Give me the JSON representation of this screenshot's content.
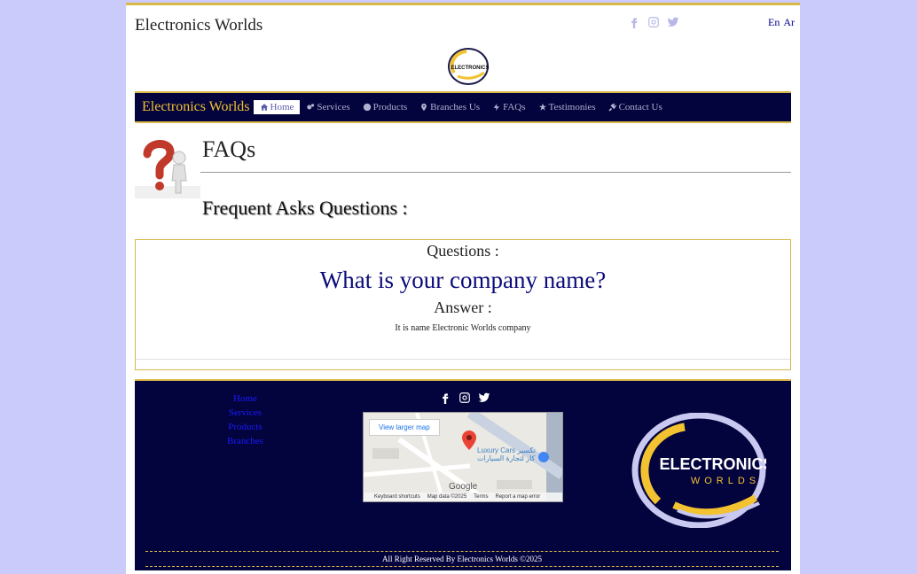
{
  "header": {
    "site_title": "Electronics Worlds",
    "lang_en": "En",
    "lang_ar": "Ar",
    "logo_text": "ELECTRONICS"
  },
  "nav": {
    "brand": "Electronics Worlds",
    "items": [
      {
        "label": "Home",
        "icon": "home-icon",
        "active": true
      },
      {
        "label": "Services",
        "icon": "gears-icon"
      },
      {
        "label": "Products",
        "icon": "product-icon"
      },
      {
        "label": "Branches Us",
        "icon": "map-pin-icon"
      },
      {
        "label": "FAQs",
        "icon": "bolt-icon"
      },
      {
        "label": "Testimonies",
        "icon": "star-icon"
      },
      {
        "label": "Contact Us",
        "icon": "plug-icon"
      }
    ]
  },
  "main": {
    "heading": "FAQs",
    "subheading": "Frequent Asks Questions :",
    "questions_label": "Questions :",
    "question": "What is your company name?",
    "answer_label": "Answer :",
    "answer": "It is name Electronic Worlds company"
  },
  "footer": {
    "links": [
      "Home",
      "Services",
      "Products",
      "Branches"
    ],
    "map": {
      "view_larger": "View larger map",
      "place_name": "Luxury Cars",
      "place_name_ar": "Luxury Cars تكسير\nكار لتجارة السيارات",
      "google": "Google",
      "shortcuts": "Keyboard shortcuts",
      "map_data": "Map data ©2025",
      "terms": "Terms",
      "report": "Report a map error"
    },
    "logo_line1": "ELECTRONICS",
    "logo_line2": "WORLDS",
    "copyright": "All Right Reserved By Electronics Worlds ©2025"
  },
  "colors": {
    "navy": "#03033d",
    "gold": "#d9b84a",
    "brand_yellow": "#f2c230",
    "background": "#cbcbfb"
  }
}
